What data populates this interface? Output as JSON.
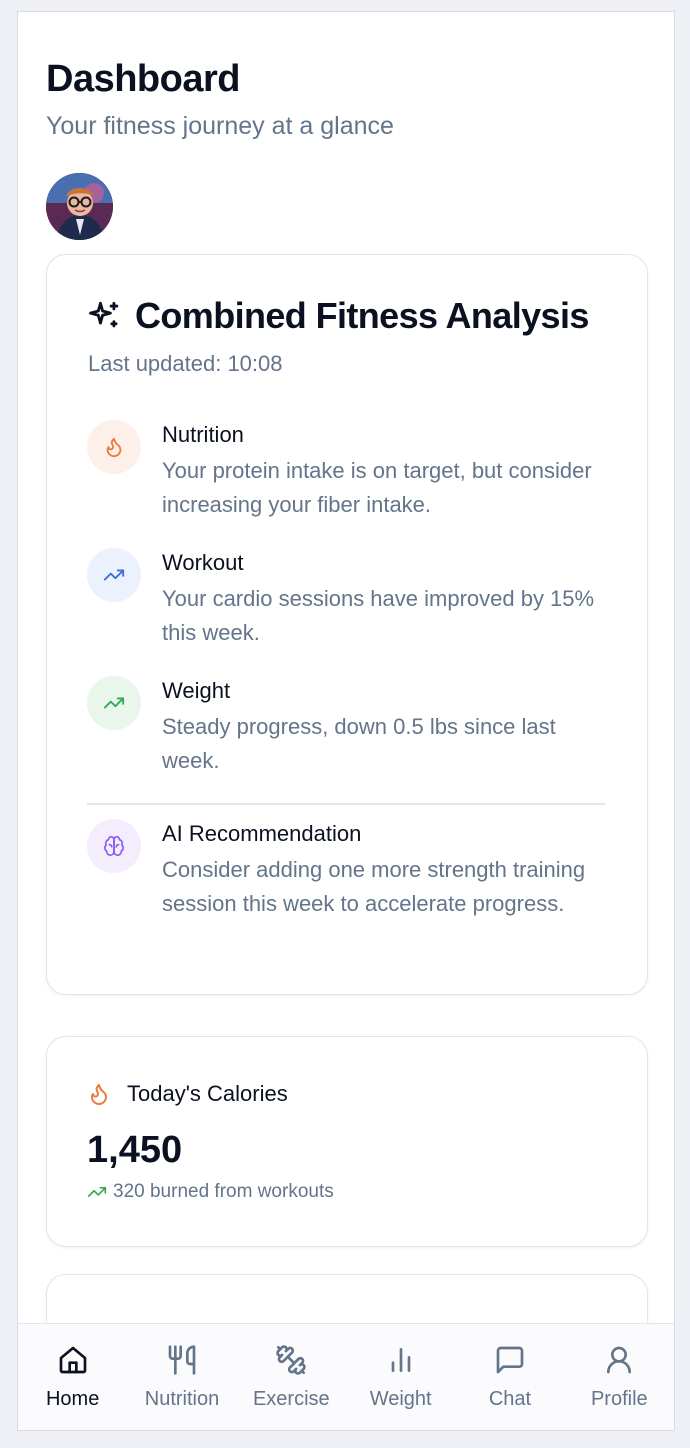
{
  "header": {
    "title": "Dashboard",
    "subtitle": "Your fitness journey at a glance"
  },
  "analysis": {
    "title": "Combined Fitness Analysis",
    "updated": "Last updated: 10:08",
    "insights": [
      {
        "title": "Nutrition",
        "text": "Your protein intake is on target, but consider increasing your fiber intake.",
        "icon": "flame-icon",
        "color": "#ea7a3b",
        "bg": "#fdf0e8"
      },
      {
        "title": "Workout",
        "text": "Your cardio sessions have improved by 15% this week.",
        "icon": "trending-up-icon",
        "color": "#3b6fd8",
        "bg": "#ebf1fd"
      },
      {
        "title": "Weight",
        "text": "Steady progress, down 0.5 lbs since last week.",
        "icon": "trending-up-icon",
        "color": "#34a853",
        "bg": "#e8f6ec"
      },
      {
        "title": "AI Recommendation",
        "text": "Consider adding one more strength training session this week to accelerate progress.",
        "icon": "brain-icon",
        "color": "#8b5cf6",
        "bg": "#f3edfd"
      }
    ]
  },
  "calories": {
    "title": "Today's Calories",
    "value": "1,450",
    "sub": "320 burned from workouts",
    "icon": "flame-icon",
    "accent": "#ea7a3b",
    "trend_color": "#34a853"
  },
  "nav": {
    "items": [
      {
        "label": "Home",
        "icon": "home-icon",
        "active": true
      },
      {
        "label": "Nutrition",
        "icon": "utensils-icon"
      },
      {
        "label": "Exercise",
        "icon": "dumbbell-icon"
      },
      {
        "label": "Weight",
        "icon": "bar-chart-icon"
      },
      {
        "label": "Chat",
        "icon": "chat-icon"
      },
      {
        "label": "Profile",
        "icon": "user-icon"
      }
    ]
  }
}
